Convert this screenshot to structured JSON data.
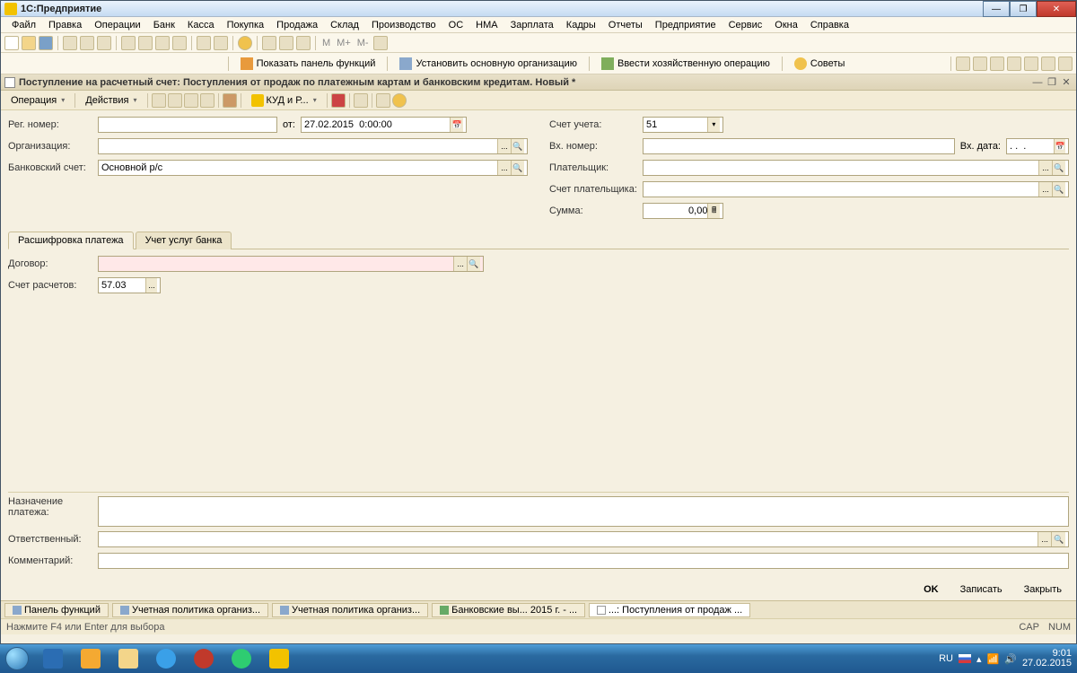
{
  "title": "1С:Предприятие",
  "menus": [
    "Файл",
    "Правка",
    "Операции",
    "Банк",
    "Касса",
    "Покупка",
    "Продажа",
    "Склад",
    "Производство",
    "ОС",
    "НМА",
    "Зарплата",
    "Кадры",
    "Отчеты",
    "Предприятие",
    "Сервис",
    "Окна",
    "Справка"
  ],
  "tb2": {
    "show_panel": "Показать панель функций",
    "set_org": "Установить основную организацию",
    "enter_op": "Ввести хозяйственную операцию",
    "tips": "Советы"
  },
  "doc_title": "Поступление на расчетный счет: Поступления от продаж по платежным картам и банковским кредитам. Новый *",
  "doc_tb": {
    "operation": "Операция",
    "actions": "Действия",
    "kud": "КУД и Р..."
  },
  "form": {
    "reg_num_lbl": "Рег. номер:",
    "ot_lbl": "от:",
    "date_val": "27.02.2015  0:00:00",
    "org_lbl": "Организация:",
    "bank_acc_lbl": "Банковский счет:",
    "bank_acc_val": "Основной р/с",
    "acc_lbl": "Счет учета:",
    "acc_val": "51",
    "in_num_lbl": "Вх. номер:",
    "in_date_lbl": "Вх. дата:",
    "in_date_val": ". .  .",
    "payer_lbl": "Плательщик:",
    "payer_acc_lbl": "Счет плательщика:",
    "sum_lbl": "Сумма:",
    "sum_val": "0,00"
  },
  "tabs": {
    "t1": "Расшифровка платежа",
    "t2": "Учет услуг банка"
  },
  "tab1": {
    "contract_lbl": "Договор:",
    "acc_calc_lbl": "Счет расчетов:",
    "acc_calc_val": "57.03"
  },
  "bottom": {
    "purpose_lbl": "Назначение\nплатежа:",
    "resp_lbl": "Ответственный:",
    "comment_lbl": "Комментарий:"
  },
  "footer_btns": {
    "ok": "OK",
    "write": "Записать",
    "close": "Закрыть"
  },
  "wnd_tabs": [
    "Панель функций",
    "Учетная политика организ...",
    "Учетная политика организ...",
    "Банковские вы... 2015 г. - ...",
    "...: Поступления от продаж ..."
  ],
  "status": {
    "hint": "Нажмите F4 или Enter для выбора",
    "cap": "CAP",
    "num": "NUM"
  },
  "tray": {
    "lang": "RU",
    "time": "9:01",
    "date": "27.02.2015"
  },
  "mtext": {
    "m": "М",
    "mplus": "M+",
    "mminus": "M-"
  }
}
